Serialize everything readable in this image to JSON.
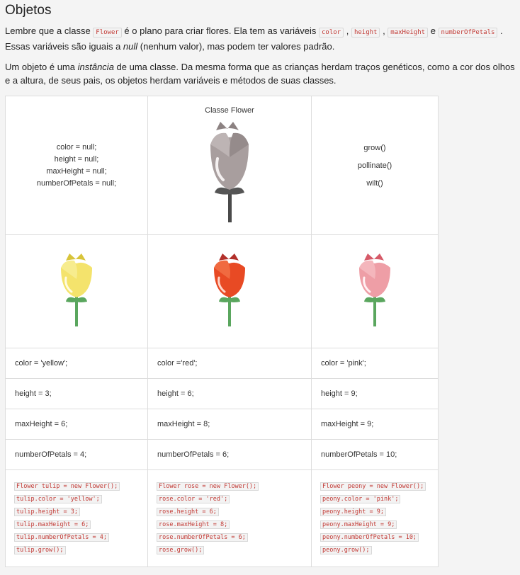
{
  "title": "Objetos",
  "para1": {
    "t1": "Lembre que a classe ",
    "c1": "Flower",
    "t2": " é o plano para criar flores. Ela tem as variáveis ",
    "c2": "color",
    "t3": " , ",
    "c3": "height",
    "t4": " , ",
    "c4": "maxHeight",
    "t5": " e ",
    "c5": "numberOfPetals",
    "t6": " . Essas variáveis são iguais a ",
    "em": "null",
    "t7": " (nenhum valor), mas podem ter valores padrão."
  },
  "para2": {
    "t1": "Um objeto é uma ",
    "em": "instância",
    "t2": " de uma classe. Da mesma forma que as crianças herdam traços genéticos, como a cor dos olhos e a altura, de seus pais, os objetos herdam variáveis e métodos de suas classes."
  },
  "class_vars": [
    "color = null;",
    "height = null;",
    "maxHeight = null;",
    "numberOfPetals = null;"
  ],
  "class_title": "Classe Flower",
  "methods": [
    "grow()",
    "pollinate()",
    "wilt()"
  ],
  "colors": {
    "gray": "#a89e9e",
    "yellow": "#f4e36c",
    "red": "#e84a24",
    "pink": "#ee9ea6",
    "stem": "#5aa65e"
  },
  "rows": [
    [
      "color = 'yellow';",
      "color ='red';",
      "color = 'pink';"
    ],
    [
      "height = 3;",
      "height = 6;",
      "height = 9;"
    ],
    [
      "maxHeight = 6;",
      "maxHeight = 8;",
      "maxHeight = 9;"
    ],
    [
      "numberOfPetals = 4;",
      "numberOfPetals = 6;",
      "numberOfPetals = 10;"
    ]
  ],
  "code": [
    [
      "Flower tulip = new Flower();",
      "tulip.color = 'yellow';",
      "tulip.height = 3;",
      "tulip.maxHeight = 6;",
      "tulip.numberOfPetals = 4;",
      "tulip.grow();"
    ],
    [
      "Flower rose = new Flower();",
      "rose.color = 'red';",
      "rose.height = 6;",
      "rose.maxHeight = 8;",
      "rose.numberOfPetals = 6;",
      "rose.grow();"
    ],
    [
      "Flower peony = new Flower();",
      "peony.color = 'pink';",
      "peony.height = 9;",
      "peony.maxHeight = 9;",
      "peony.numberOfPetals = 10;",
      "peony.grow();"
    ]
  ]
}
